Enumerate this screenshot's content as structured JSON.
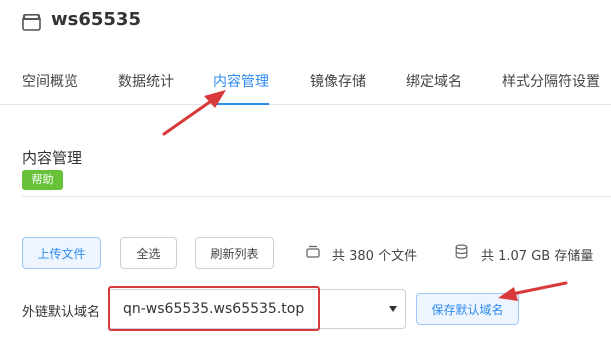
{
  "header": {
    "bucket_name": "ws65535",
    "icon": "bucket-icon"
  },
  "tabs": [
    {
      "label": "空间概览"
    },
    {
      "label": "数据统计"
    },
    {
      "label": "内容管理",
      "active": true
    },
    {
      "label": "镜像存储"
    },
    {
      "label": "绑定域名"
    },
    {
      "label": "样式分隔符设置"
    }
  ],
  "section": {
    "title": "内容管理",
    "help_label": "帮助"
  },
  "toolbar": {
    "upload_label": "上传文件",
    "select_all_label": "全选",
    "refresh_label": "刷新列表",
    "file_count_text": "共 380 个文件",
    "storage_text": "共 1.07 GB 存储量"
  },
  "domain": {
    "label": "外链默认域名",
    "selected_value": "qn-ws65535.ws65535.top",
    "save_label": "保存默认域名"
  },
  "colors": {
    "accent": "#2d8cf0",
    "help_badge": "#67c23a",
    "annotation_red": "#d9393b"
  },
  "annotations": {
    "arrows": 2,
    "highlight_box": "domain select value"
  }
}
